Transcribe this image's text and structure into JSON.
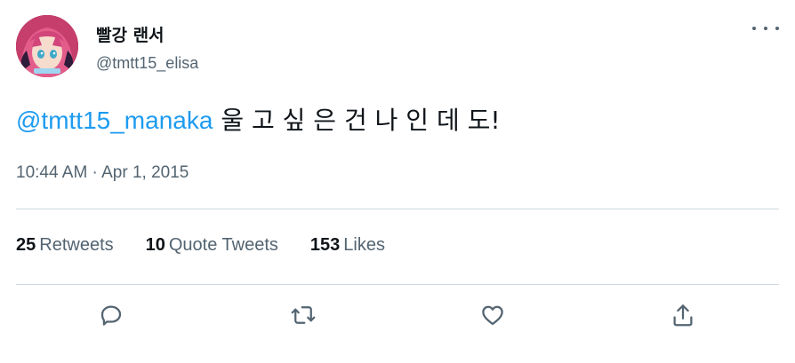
{
  "tweet": {
    "author": {
      "display_name": "빨강 랜서",
      "handle": "@tmtt15_elisa"
    },
    "text": {
      "mention": "@tmtt15_manaka",
      "body": "울 고 싶 은 건 나 인 데 도!"
    },
    "timestamp": "10:44 AM · Apr 1, 2015",
    "stats": {
      "retweets": {
        "count": "25",
        "label": "Retweets"
      },
      "quote_tweets": {
        "count": "10",
        "label": "Quote Tweets"
      },
      "likes": {
        "count": "153",
        "label": "Likes"
      }
    },
    "actions": [
      "reply-icon",
      "retweet-icon",
      "like-icon",
      "share-icon"
    ]
  },
  "colors": {
    "text_primary": "#0f1419",
    "text_secondary": "#536471",
    "link": "#1d9bf0",
    "divider": "#cfd9de"
  }
}
